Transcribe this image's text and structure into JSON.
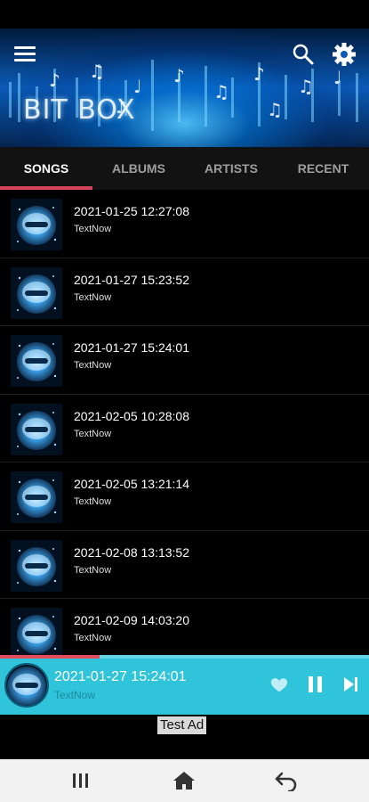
{
  "header": {
    "logo_text": "BIT BOX",
    "menu_icon": "hamburger-menu-icon",
    "search_icon": "search-icon",
    "settings_icon": "gear-icon"
  },
  "tabs": [
    {
      "label": "SONGS",
      "active": true
    },
    {
      "label": "ALBUMS",
      "active": false
    },
    {
      "label": "ARTISTS",
      "active": false
    },
    {
      "label": "RECENT",
      "active": false
    }
  ],
  "songs": [
    {
      "title": "2021-01-25 12:27:08",
      "artist": "TextNow"
    },
    {
      "title": "2021-01-27 15:23:52",
      "artist": "TextNow"
    },
    {
      "title": "2021-01-27 15:24:01",
      "artist": "TextNow"
    },
    {
      "title": "2021-02-05 10:28:08",
      "artist": "TextNow"
    },
    {
      "title": "2021-02-05 13:21:14",
      "artist": "TextNow"
    },
    {
      "title": "2021-02-08 13:13:52",
      "artist": "TextNow"
    },
    {
      "title": "2021-02-09 14:03:20",
      "artist": "TextNow"
    }
  ],
  "now_playing": {
    "title": "2021-01-27 15:24:01",
    "artist": "TextNow",
    "progress": 0.27,
    "icons": [
      "heart-icon",
      "pause-icon",
      "skip-next-icon"
    ]
  },
  "ad": {
    "label": "Test Ad"
  },
  "navbar": {
    "icons": [
      "recent-apps-icon",
      "home-icon",
      "back-icon"
    ]
  },
  "colors": {
    "accent": "#d6455a",
    "player_bg": "#2fc4da",
    "tab_bar_bg": "#121212"
  }
}
